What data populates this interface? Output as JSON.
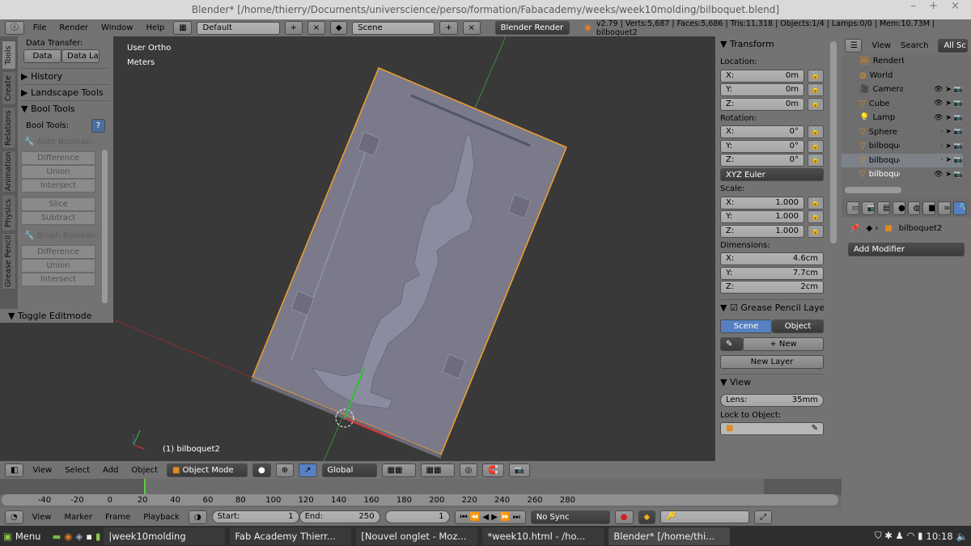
{
  "window": {
    "title": "Blender* [/home/thierry/Documents/universcience/perso/formation/Fabacademy/weeks/week10molding/bilboquet.blend]",
    "controls": "– + ×"
  },
  "info_header": {
    "menus": [
      "File",
      "Render",
      "Window",
      "Help"
    ],
    "layout": "Default",
    "scene": "Scene",
    "engine": "Blender Render",
    "stats": "v2.79 | Verts:5,687 | Faces:5,686 | Tris:11,318 | Objects:1/4 | Lamps:0/0 | Mem:10.73M | bilboquet2"
  },
  "tool_tabs": [
    "Tools",
    "Create",
    "Relations",
    "Animation",
    "Physics",
    "Grease Pencil"
  ],
  "tool_shelf": {
    "data_transfer_label": "Data Transfer:",
    "data_btn": "Data",
    "data_layers_btn": "Data La",
    "history": "History",
    "landscape": "Landscape Tools",
    "bool_tools": "Bool Tools",
    "bool_tools_label": "Bool Tools:",
    "auto_boolean": "Auto Boolean:",
    "auto_buttons": [
      "Difference",
      "Union",
      "Intersect",
      "Slice",
      "Subtract"
    ],
    "brush_boolean": "Brush Boolean:",
    "brush_buttons": [
      "Difference",
      "Union",
      "Intersect"
    ],
    "toggle_editmode": "Toggle Editmode"
  },
  "viewport": {
    "view_name": "User Ortho",
    "units": "Meters",
    "object_label": "(1) bilboquet2",
    "mesh_color": "#7a7a8a",
    "selection_color": "#f0a030"
  },
  "n_panel": {
    "transform": "Transform",
    "location": "Location:",
    "loc": [
      {
        "axis": "X:",
        "value": "0m"
      },
      {
        "axis": "Y:",
        "value": "0m"
      },
      {
        "axis": "Z:",
        "value": "0m"
      }
    ],
    "rotation": "Rotation:",
    "rot": [
      {
        "axis": "X:",
        "value": "0°"
      },
      {
        "axis": "Y:",
        "value": "0°"
      },
      {
        "axis": "Z:",
        "value": "0°"
      }
    ],
    "rotation_mode": "XYZ Euler",
    "scale": "Scale:",
    "scl": [
      {
        "axis": "X:",
        "value": "1.000"
      },
      {
        "axis": "Y:",
        "value": "1.000"
      },
      {
        "axis": "Z:",
        "value": "1.000"
      }
    ],
    "dimensions": "Dimensions:",
    "dim": [
      {
        "axis": "X:",
        "value": "4.6cm"
      },
      {
        "axis": "Y:",
        "value": "7.7cm"
      },
      {
        "axis": "Z:",
        "value": "2cm"
      }
    ],
    "grease_pencil": "Grease Pencil Layers",
    "gp_scene": "Scene",
    "gp_object": "Object",
    "gp_new": "New",
    "gp_new_layer": "New Layer",
    "view": "View",
    "lens_label": "Lens:",
    "lens_value": "35mm",
    "lock_to_object": "Lock to Object:"
  },
  "outliner": {
    "menus": [
      "View",
      "Search"
    ],
    "filter": "All Sc",
    "items": [
      "RenderL",
      "World",
      "Camera",
      "Cube",
      "Lamp",
      "Sphere",
      "bilboque",
      "bilboque",
      "bilboque"
    ]
  },
  "properties": {
    "object_name": "bilboquet2",
    "add_modifier": "Add Modifier"
  },
  "view3d_header": {
    "menus": [
      "View",
      "Select",
      "Add",
      "Object"
    ],
    "mode": "Object Mode",
    "orientation": "Global"
  },
  "timeline": {
    "ticks": [
      "-40",
      "-20",
      "0",
      "20",
      "40",
      "60",
      "80",
      "100",
      "120",
      "140",
      "160",
      "180",
      "200",
      "220",
      "240",
      "260",
      "280"
    ],
    "current_frame_marker": 0,
    "menus": [
      "View",
      "Marker",
      "Frame",
      "Playback"
    ],
    "start_label": "Start:",
    "start": "1",
    "end_label": "End:",
    "end": "250",
    "current": "1",
    "sync": "No Sync"
  },
  "taskbar": {
    "menu": "Menu",
    "tasks": [
      "|week10molding",
      "Fab Academy Thierr...",
      "[Nouvel onglet - Moz...",
      "*week10.html - /ho...",
      "Blender* [/home/thi..."
    ],
    "clock": "10:18"
  }
}
